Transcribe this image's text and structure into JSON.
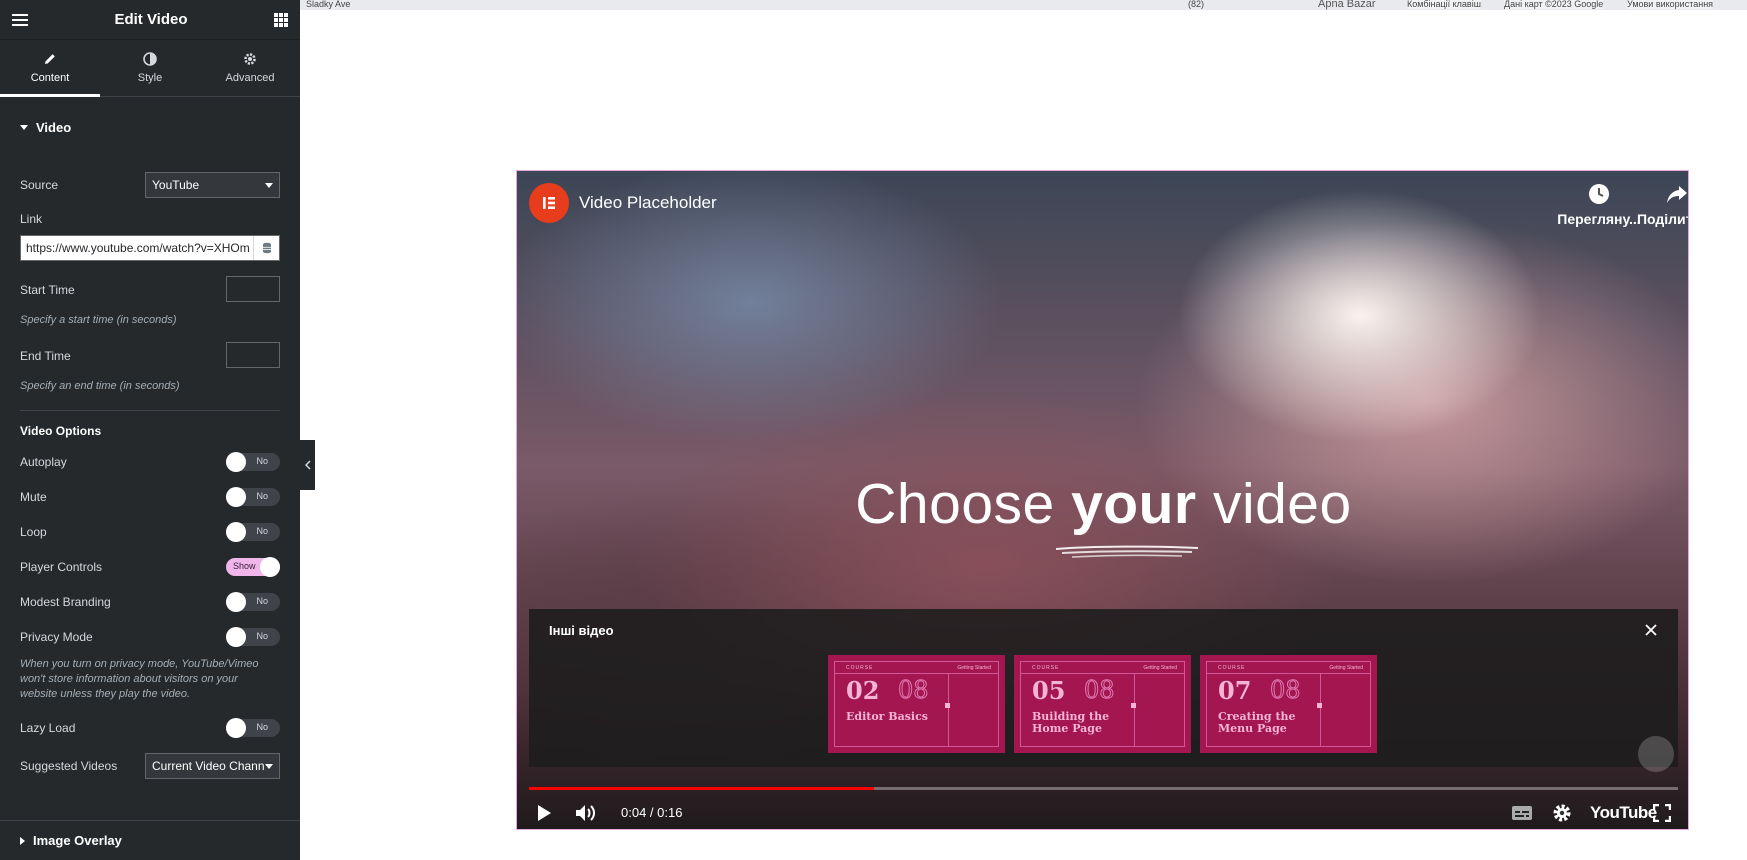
{
  "header": {
    "title": "Edit Video"
  },
  "tabs": [
    {
      "label": "Content",
      "icon": "pencil-icon"
    },
    {
      "label": "Style",
      "icon": "half-circle-icon"
    },
    {
      "label": "Advanced",
      "icon": "gear-icon"
    }
  ],
  "section": {
    "title": "Video"
  },
  "source": {
    "label": "Source",
    "value": "YouTube"
  },
  "link": {
    "label": "Link",
    "value": "https://www.youtube.com/watch?v=XHOm"
  },
  "start_time": {
    "label": "Start Time",
    "value": "",
    "note": "Specify a start time (in seconds)"
  },
  "end_time": {
    "label": "End Time",
    "value": "",
    "note": "Specify an end time (in seconds)"
  },
  "video_options": {
    "title": "Video Options",
    "items": [
      {
        "label": "Autoplay",
        "state": "No"
      },
      {
        "label": "Mute",
        "state": "No"
      },
      {
        "label": "Loop",
        "state": "No"
      },
      {
        "label": "Player Controls",
        "state": "Show"
      },
      {
        "label": "Modest Branding",
        "state": "No"
      },
      {
        "label": "Privacy Mode",
        "state": "No"
      }
    ],
    "privacy_note": "When you turn on privacy mode, YouTube/Vimeo won't store information about visitors on your website unless they play the video.",
    "lazy_load": {
      "label": "Lazy Load",
      "state": "No"
    },
    "suggested": {
      "label": "Suggested Videos",
      "value": "Current Video Chann"
    }
  },
  "image_overlay": {
    "title": "Image Overlay"
  },
  "map": {
    "street": "Sladky Ave",
    "road": "(82)",
    "place": "Apna Bazar",
    "shortcuts": "Комбінації клавіш",
    "mapdata": "Дані карт ©2023 Google",
    "terms": "Умови використання"
  },
  "video": {
    "channel_title": "Video Placeholder",
    "watch_later": "Перегляну...",
    "share": "Поділитися",
    "headline_pre": "Choose ",
    "headline_bold": "your",
    "headline_post": " video",
    "suggest_title": "Інші відео",
    "cards": [
      {
        "course": "COURSE",
        "tag": "Getting Started",
        "num": "02",
        "total": "08",
        "caption": "Editor Basics"
      },
      {
        "course": "COURSE",
        "tag": "Getting Started",
        "num": "05",
        "total": "08",
        "caption": "Building the Home Page"
      },
      {
        "course": "COURSE",
        "tag": "Getting Started",
        "num": "07",
        "total": "08",
        "caption": "Creating the Menu Page"
      }
    ],
    "time": "0:04 / 0:16",
    "progress": 0.3,
    "brand": "YouTube"
  },
  "colors": {
    "accent": "#f0b6ea",
    "panel": "#26292c",
    "logo": "#e83d1d",
    "card": "#a3164f",
    "progress": "#ff0000"
  }
}
